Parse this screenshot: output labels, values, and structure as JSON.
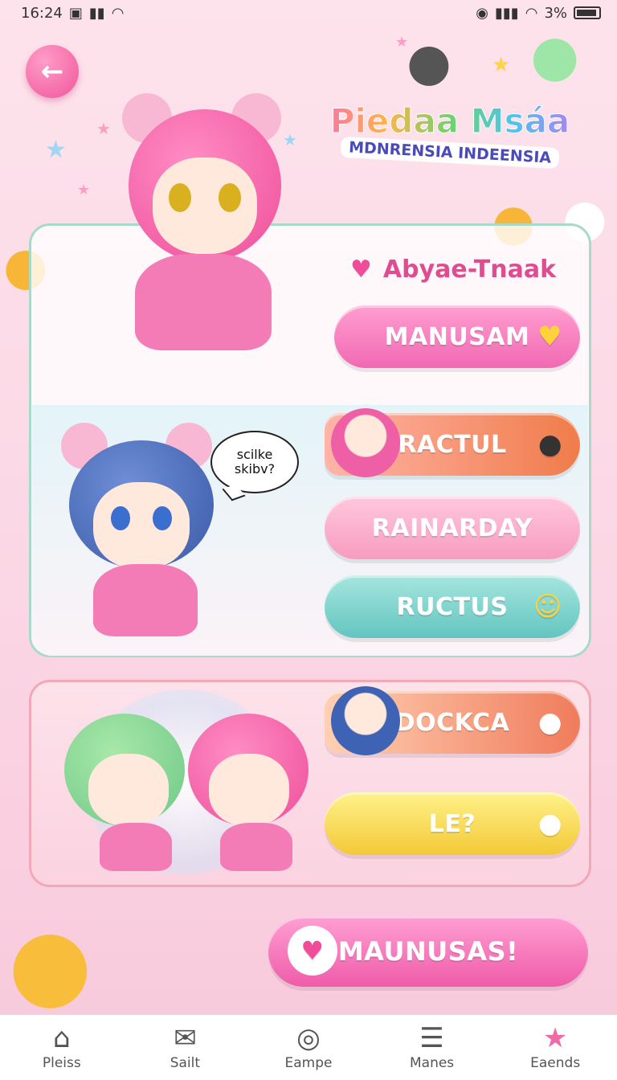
{
  "status_bar": {
    "time": "16:24",
    "battery": "3%"
  },
  "logo": {
    "line1": "Piedaa Msáa",
    "line2": "MDNRENSIA INDEENSIA"
  },
  "bubble": {
    "text": "scilke skibv?"
  },
  "heading": {
    "title": "Abyae-Tnaak"
  },
  "buttons": {
    "manusam": "MANUSAM",
    "ractul": "RACTUL",
    "rainarday": "RAINARDAY",
    "ructus": "RUCTUS",
    "dockca": "DOCKCA",
    "le": "LE?",
    "main": "MAUNUSAS!"
  },
  "tabs": [
    {
      "label": "Pleiss",
      "icon": "home-icon"
    },
    {
      "label": "Sailt",
      "icon": "mail-icon"
    },
    {
      "label": "Eampe",
      "icon": "settings-icon"
    },
    {
      "label": "Manes",
      "icon": "menu-icon"
    },
    {
      "label": "Eaends",
      "icon": "star-icon"
    }
  ],
  "colors": {
    "background": "#fde3ec",
    "accent_pink": "#f06aa8",
    "teal": "#63c5c0",
    "yellow": "#f3c837"
  }
}
